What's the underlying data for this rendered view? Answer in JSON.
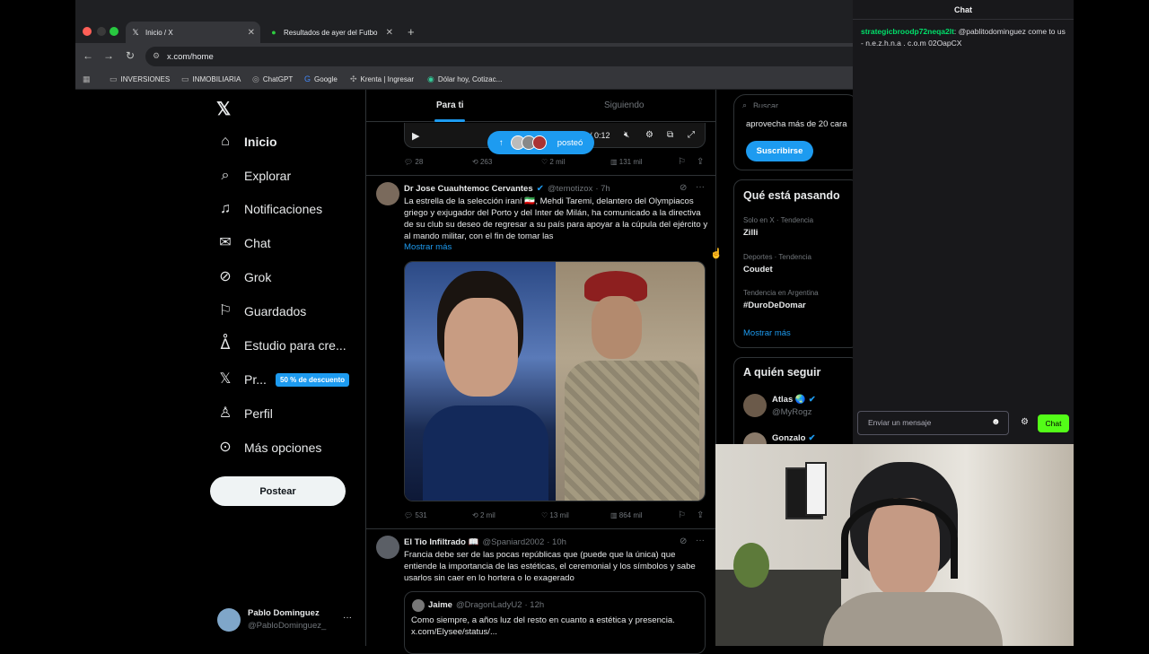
{
  "browser": {
    "tabs": [
      {
        "icon": "x-logo-icon",
        "title": "Inicio / X",
        "active": true
      },
      {
        "icon": "soccer-icon",
        "title": "Resultados de ayer del Futbo",
        "active": false
      }
    ],
    "new_tab": "+",
    "url": "x.com/home",
    "bookmarks": [
      {
        "icon": "folder-icon",
        "label": "INVERSIONES"
      },
      {
        "icon": "folder-icon",
        "label": "INMOBILIARIA"
      },
      {
        "icon": "chatgpt-icon",
        "label": "ChatGPT"
      },
      {
        "icon": "google-icon",
        "label": "Google"
      },
      {
        "icon": "krenta-icon",
        "label": "Krenta | Ingresar"
      },
      {
        "icon": "dolar-icon",
        "label": "Dólar hoy, Cotizac..."
      }
    ]
  },
  "nav": {
    "items": [
      {
        "icon": "home-icon",
        "label": "Inicio"
      },
      {
        "icon": "search-icon",
        "label": "Explorar"
      },
      {
        "icon": "bell-icon",
        "label": "Notificaciones"
      },
      {
        "icon": "mail-icon",
        "label": "Chat"
      },
      {
        "icon": "grok-icon",
        "label": "Grok"
      },
      {
        "icon": "bookmark-icon",
        "label": "Guardados"
      },
      {
        "icon": "creator-icon",
        "label": "Estudio para cre..."
      },
      {
        "icon": "x-premium-icon",
        "label": "Pr..."
      },
      {
        "icon": "person-icon",
        "label": "Perfil"
      },
      {
        "icon": "more-icon",
        "label": "Más opciones"
      }
    ],
    "premium_badge": "50 % de descuento",
    "post_button": "Postear",
    "account": {
      "name": "Pablo Dominguez",
      "handle": "@PabloDominguez_",
      "more": "···"
    }
  },
  "feed": {
    "tabs": [
      "Para ti",
      "Siguiendo"
    ],
    "video": {
      "time": "/ 0:12",
      "posted_pill": "posteó"
    },
    "tweet0_actions": {
      "replies": "28",
      "retweets": "263",
      "likes": "2 mil",
      "views": "131 mil"
    },
    "tweet1": {
      "name": "Dr Jose Cuauhtemoc Cervantes",
      "handle": "@temotizox",
      "time": "· 7h",
      "text": "La estrella de la selección iraní 🇮🇷, Mehdi Taremi, delantero del Olympiacos griego y exjugador del Porto y del Inter de Milán, ha comunicado a la directiva de su club su deseo de regresar a su país para apoyar a la cúpula del ejército y al mando militar, con el fin de tomar las",
      "more": "Mostrar más",
      "actions": {
        "replies": "531",
        "retweets": "2 mil",
        "likes": "13 mil",
        "views": "864 mil"
      }
    },
    "tweet2": {
      "name": "El Tio Infiltrado 📖",
      "handle": "@Spaniard2002",
      "time": "· 10h",
      "text": "Francia debe ser de las pocas repúblicas que (puede que la única) que entiende la importancia de las estéticas, el ceremonial y los símbolos y sabe usarlos sin caer en lo hortera o lo exagerado",
      "quote": {
        "name": "Jaime",
        "handle": "@DragonLadyU2",
        "time": "· 12h",
        "text": "Como siempre, a años luz del resto en cuanto a estética y presencia. x.com/Elysee/status/..."
      }
    }
  },
  "sidebar": {
    "search_placeholder": "Buscar",
    "premium_text": "aprovecha más de 20 cara",
    "subscribe": "Suscribirse",
    "trends_title": "Qué está pasando",
    "trends": [
      {
        "context": "Solo en X · Tendencia",
        "name": "Zilli"
      },
      {
        "context": "Deportes · Tendencia",
        "name": "Coudet"
      },
      {
        "context": "Tendencia en Argentina",
        "name": "#DuroDeDomar"
      }
    ],
    "show_more": "Mostrar más",
    "follow_title": "A quién seguir",
    "follow": [
      {
        "name": "Atlas 🌏",
        "handle": "@MyRogz"
      },
      {
        "name": "Gonzalo",
        "handle": ""
      }
    ]
  },
  "chat": {
    "title": "Chat",
    "message_user": "strategicbroodp72neqa2lt",
    "message_text": ": @pablitodominguez come to us - n.e.z.h.n.a . c.o.m 02OapCX",
    "input_placeholder": "Enviar un mensaje",
    "send": "Chat"
  },
  "colors": {
    "accent": "#1d9bf0",
    "chat_send": "#53fc18",
    "chat_user": "#00e06a"
  }
}
